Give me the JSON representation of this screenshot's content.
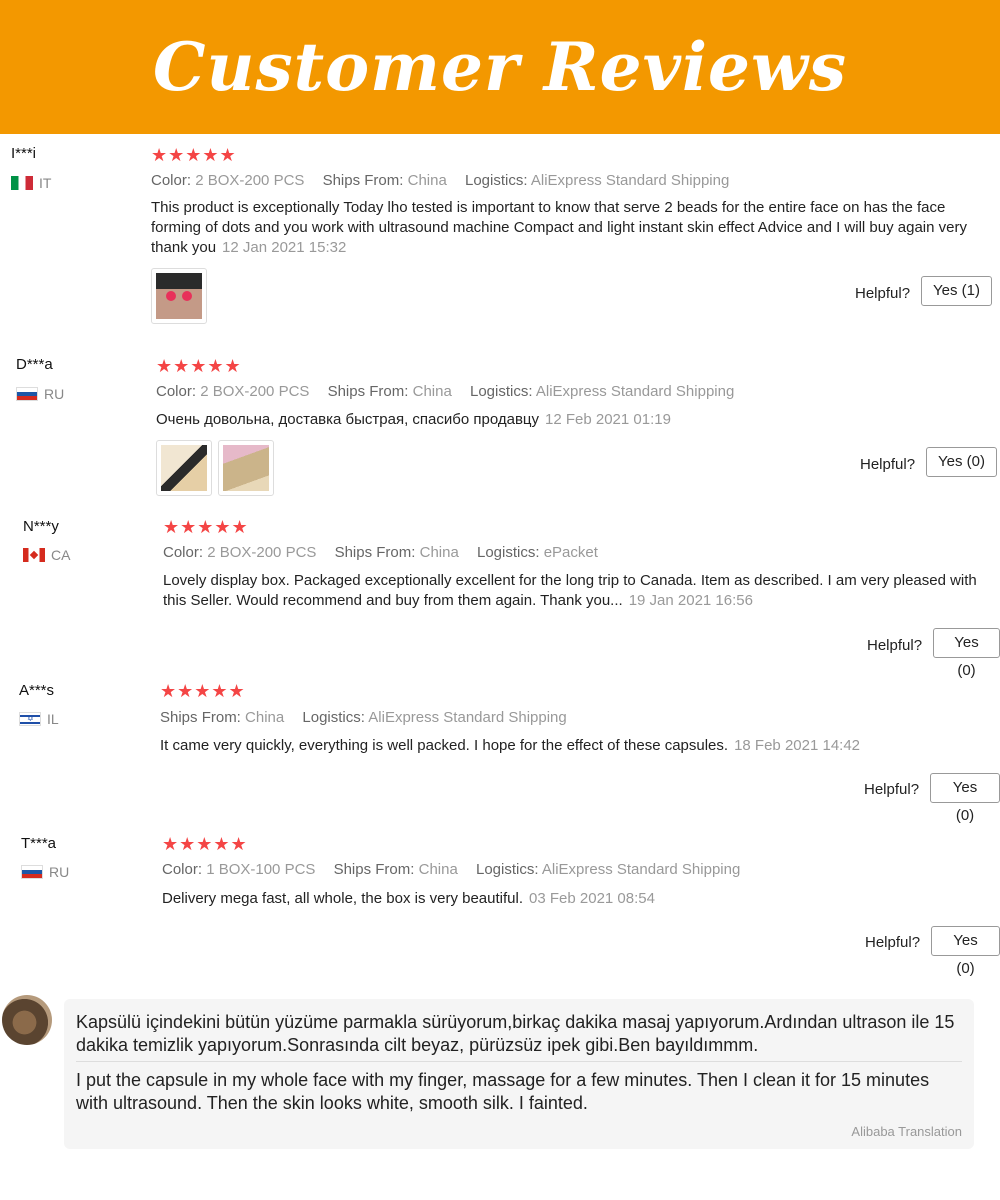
{
  "header": {
    "title": "Customer Reviews"
  },
  "colors": {
    "banner": "#f39800",
    "stars": "#f44545"
  },
  "labels": {
    "color": "Color:",
    "ships_from": "Ships From:",
    "logistics": "Logistics:",
    "helpful": "Helpful?"
  },
  "reviews": [
    {
      "user": "I***i",
      "country": "IT",
      "flag": "flag-italy-icon",
      "rating": 5,
      "color": "2 BOX-200 PCS",
      "ships_from": "China",
      "logistics": "AliExpress Standard Shipping",
      "text": "This product is exceptionally Today lho tested is important to know that serve 2 beads for the entire face on has the face forming of dots and you work with ultrasound machine Compact and light instant skin effect Advice and I will buy again very thank you",
      "date": "12 Jan 2021 15:32",
      "yes": "Yes (1)",
      "photos": [
        "face-photo"
      ]
    },
    {
      "user": "D***a",
      "country": "RU",
      "flag": "flag-russia-icon",
      "rating": 5,
      "color": "2 BOX-200 PCS",
      "ships_from": "China",
      "logistics": "AliExpress Standard Shipping",
      "text": "Очень довольна, доставка быстрая, спасибо продавцу",
      "date": "12 Feb 2021 01:19",
      "yes": "Yes (0)",
      "photos": [
        "box-photo-1",
        "box-photo-2"
      ]
    },
    {
      "user": "N***y",
      "country": "CA",
      "flag": "flag-canada-icon",
      "rating": 5,
      "color": "2 BOX-200 PCS",
      "ships_from": "China",
      "logistics": "ePacket",
      "text": "Lovely display box. Packaged exceptionally excellent for the long trip to Canada. Item as described. I am very pleased with this Seller. Would recommend and buy from them again. Thank you...",
      "date": "19 Jan 2021 16:56",
      "yes": "Yes (0)",
      "photos": []
    },
    {
      "user": "A***s",
      "country": "IL",
      "flag": "flag-israel-icon",
      "rating": 5,
      "ships_from": "China",
      "logistics": "AliExpress Standard Shipping",
      "text": "It came very quickly, everything is well packed. I hope for the effect of these capsules.",
      "date": "18 Feb 2021 14:42",
      "yes": "Yes (0)",
      "photos": []
    },
    {
      "user": "T***a",
      "country": "RU",
      "flag": "flag-russia-icon",
      "rating": 5,
      "color": "1 BOX-100 PCS",
      "ships_from": "China",
      "logistics": "AliExpress Standard Shipping",
      "text": "Delivery mega fast, all whole, the box is very beautiful.",
      "date": "03 Feb 2021 08:54",
      "yes": "Yes (0)",
      "photos": []
    }
  ],
  "stars_text": "★★★★★",
  "comment": {
    "original": "Kapsülü içindekini  bütün yüzüme parmakla sürüyorum,birkaç dakika  masaj yapıyorum.Ardından ultrason ile  15 dakika  temizlik yapıyorum.Sonrasında cilt beyaz, pürüzsüz ipek gibi.Ben bayıldımmm.",
    "translation": "I put the capsule in my whole face with my finger, massage for a few minutes. Then I clean it for 15 minutes with ultrasound. Then the skin looks white, smooth silk. I fainted.",
    "credit": "Alibaba Translation"
  }
}
